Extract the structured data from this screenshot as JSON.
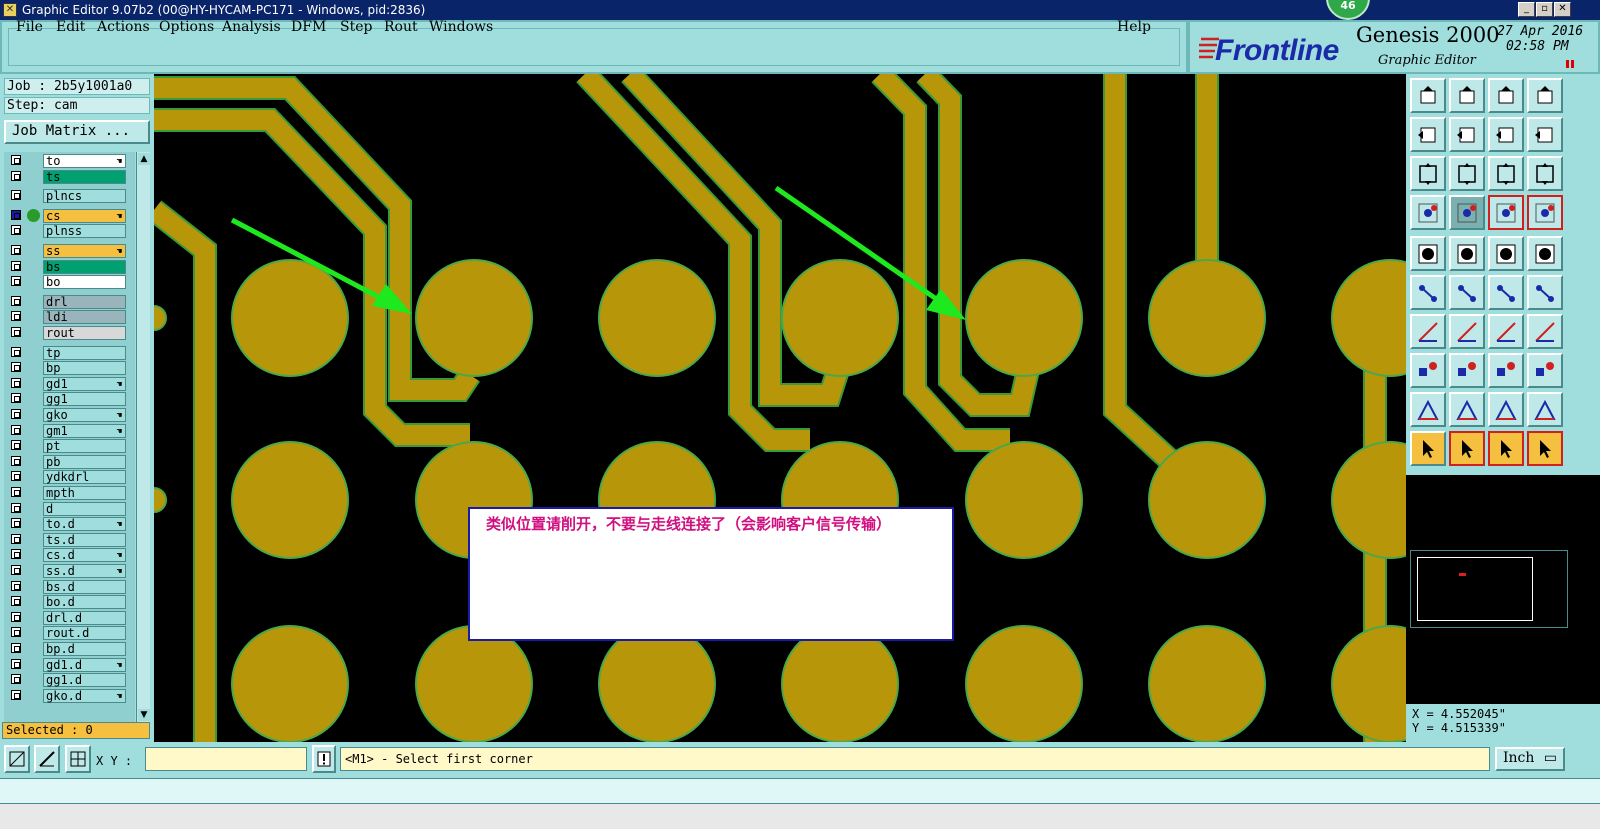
{
  "window": {
    "title": "Graphic Editor 9.07b2 (00@HY-HYCAM-PC171 - Windows, pid:2836)",
    "badge": "46"
  },
  "menu": [
    {
      "label": "File"
    },
    {
      "label": "Edit"
    },
    {
      "label": "Actions"
    },
    {
      "label": "Options"
    },
    {
      "label": "Analysis"
    },
    {
      "label": "DFM"
    },
    {
      "label": "Step"
    },
    {
      "label": "Rout"
    },
    {
      "label": "Windows"
    },
    {
      "label": "Help"
    }
  ],
  "brand": {
    "logo": "Frontline",
    "product": "Genesis 2000",
    "subtitle": "Graphic Editor",
    "date": "27 Apr 2016",
    "time": "02:58 PM"
  },
  "job": {
    "job_line": "Job : 2b5y1001a0",
    "step_line": "Step: cam",
    "matrix_button": "Job Matrix ..."
  },
  "layers": [
    {
      "name": "to",
      "color": "#ffffff",
      "affected": true
    },
    {
      "name": "ts",
      "color": "#00a070",
      "affected": false
    },
    {
      "name": "plncs",
      "color": "#a0dede",
      "affected": false
    },
    {
      "name": "cs",
      "color": "#f5c040",
      "affected": true,
      "work": true
    },
    {
      "name": "plnss",
      "color": "#a0dede",
      "affected": false
    },
    {
      "name": "ss",
      "color": "#f5c040",
      "affected": true
    },
    {
      "name": "bs",
      "color": "#00a070",
      "affected": false
    },
    {
      "name": "bo",
      "color": "#ffffff",
      "affected": false
    },
    {
      "name": "drl",
      "color": "#9ab4bc",
      "affected": false
    },
    {
      "name": "ldi",
      "color": "#9ab4bc",
      "affected": false
    },
    {
      "name": "rout",
      "color": "#d8d8d8",
      "affected": false
    },
    {
      "name": "tp",
      "color": "#a0dede",
      "affected": false
    },
    {
      "name": "bp",
      "color": "#a0dede",
      "affected": false
    },
    {
      "name": "gd1",
      "color": "#a0dede",
      "affected": true
    },
    {
      "name": "gg1",
      "color": "#a0dede",
      "affected": false
    },
    {
      "name": "gko",
      "color": "#a0dede",
      "affected": true
    },
    {
      "name": "gm1",
      "color": "#a0dede",
      "affected": true
    },
    {
      "name": "pt",
      "color": "#a0dede",
      "affected": false
    },
    {
      "name": "pb",
      "color": "#a0dede",
      "affected": false
    },
    {
      "name": "ydkdrl",
      "color": "#a0dede",
      "affected": false
    },
    {
      "name": "mpth",
      "color": "#a0dede",
      "affected": false
    },
    {
      "name": "d",
      "color": "#a0dede",
      "affected": false
    },
    {
      "name": "to.d",
      "color": "#a0dede",
      "affected": true
    },
    {
      "name": "ts.d",
      "color": "#a0dede",
      "affected": false
    },
    {
      "name": "cs.d",
      "color": "#a0dede",
      "affected": true
    },
    {
      "name": "ss.d",
      "color": "#a0dede",
      "affected": true
    },
    {
      "name": "bs.d",
      "color": "#a0dede",
      "affected": false
    },
    {
      "name": "bo.d",
      "color": "#a0dede",
      "affected": false
    },
    {
      "name": "drl.d",
      "color": "#a0dede",
      "affected": false
    },
    {
      "name": "rout.d",
      "color": "#a0dede",
      "affected": false
    },
    {
      "name": "bp.d",
      "color": "#a0dede",
      "affected": false
    },
    {
      "name": "gd1.d",
      "color": "#a0dede",
      "affected": true
    },
    {
      "name": "gg1.d",
      "color": "#a0dede",
      "affected": false
    },
    {
      "name": "gko.d",
      "color": "#a0dede",
      "affected": true
    }
  ],
  "selected": "Selected : 0",
  "callout": {
    "text": "类似位置请削开，不要与走线连接了（会影响客户信号传输）"
  },
  "coords": {
    "x": "X = 4.552045\"",
    "y": "Y = 4.515339\""
  },
  "bottom": {
    "xy_label": "X Y :",
    "xy_value": "",
    "prompt": "<M1> - Select first corner",
    "unit": "Inch"
  },
  "colors": {
    "panel": "#a0dede",
    "copper": "#b8960a",
    "copper_outline": "#4aa84a",
    "arrow": "#1ee81e",
    "callout_text": "#d01080"
  }
}
